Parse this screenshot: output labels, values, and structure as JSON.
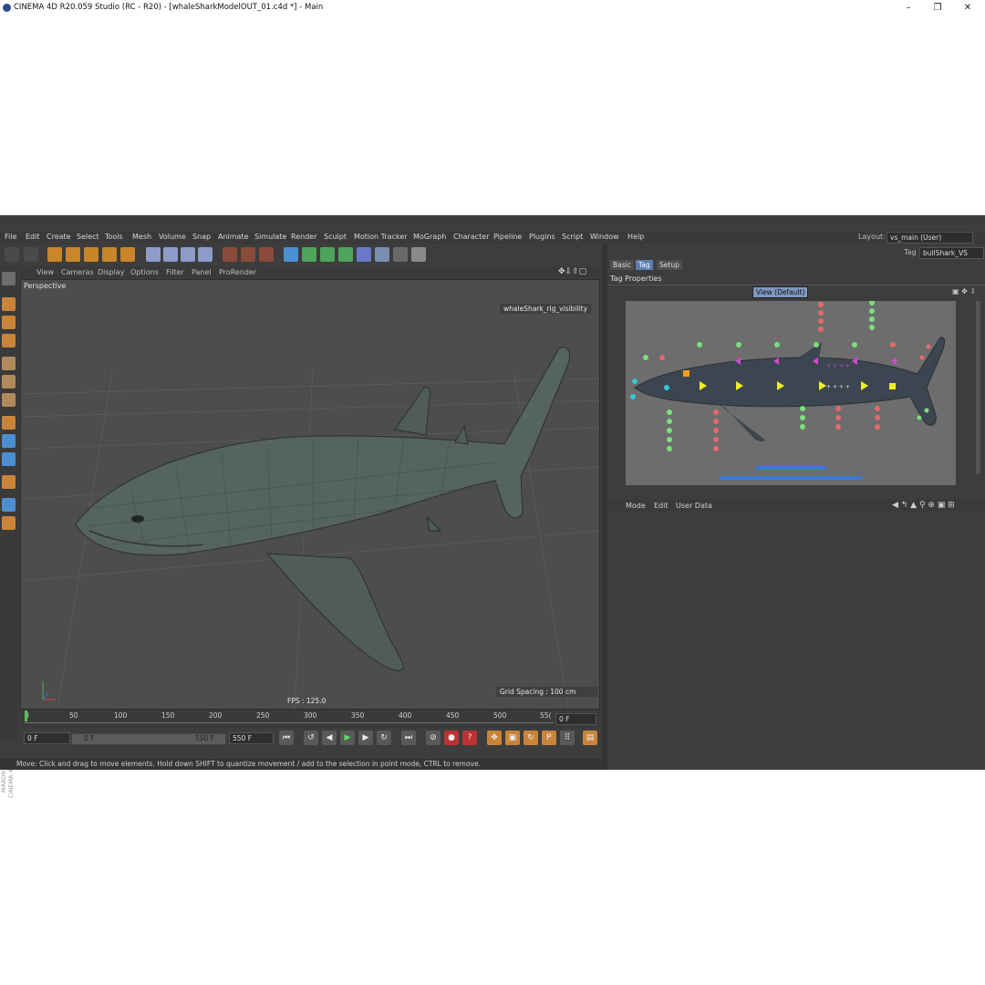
{
  "window": {
    "title": "CINEMA 4D R20.059 Studio (RC - R20) - [whaleSharkModelOUT_01.c4d *] - Main",
    "minimize": "–",
    "maximize": "❐",
    "close": "✕"
  },
  "menu": {
    "items": [
      "File",
      "Edit",
      "Create",
      "Select",
      "Tools",
      "Mesh",
      "Volume",
      "Snap",
      "Animate",
      "Simulate",
      "Render",
      "Sculpt",
      "Motion Tracker",
      "MoGraph",
      "Character",
      "Pipeline",
      "Plugins",
      "Script",
      "Window",
      "Help"
    ],
    "layout_label": "Layout:",
    "layout_value": "vs_main (User)"
  },
  "viewport": {
    "menu": [
      "View",
      "Cameras",
      "Display",
      "Options",
      "Filter",
      "Panel",
      "ProRender"
    ],
    "camera": "Perspective",
    "object_label": "whaleShark_rig_visibility",
    "fps": "FPS : 125.0",
    "grid_spacing": "Grid Spacing : 100 cm"
  },
  "timeline": {
    "ticks": [
      "0",
      "50",
      "100",
      "150",
      "200",
      "250",
      "300",
      "350",
      "400",
      "450",
      "500",
      "55("
    ],
    "current_frame_right": "0 F",
    "start_field": "0 F",
    "range_start": "0 F",
    "range_end": "550 F",
    "end_field": "550 F"
  },
  "status": {
    "text": "Move: Click and drag to move elements. Hold down SHIFT to quantize movement / add to the selection in point mode, CTRL to remove."
  },
  "branding": "MAXON CINEMA 4D",
  "attributes": {
    "tag_label": "Tag",
    "tag_value": "bullShark_VS",
    "tabs": [
      "Basic",
      "Tag",
      "Setup"
    ],
    "active_tab": "Tag",
    "section": "Tag Properties",
    "view_button": "View (Default)",
    "preview_text": "+ + + +",
    "lower_menu": [
      "Mode",
      "Edit",
      "User Data"
    ]
  },
  "colors": {
    "accent_blue": "#5a7fb0",
    "dot_green": "#7be07b",
    "dot_red": "#e46a6a",
    "dot_magenta": "#d04bd0",
    "dot_yellow": "#f0f020",
    "dot_cyan": "#39c6d6",
    "bar_blue": "#3a78d8"
  }
}
